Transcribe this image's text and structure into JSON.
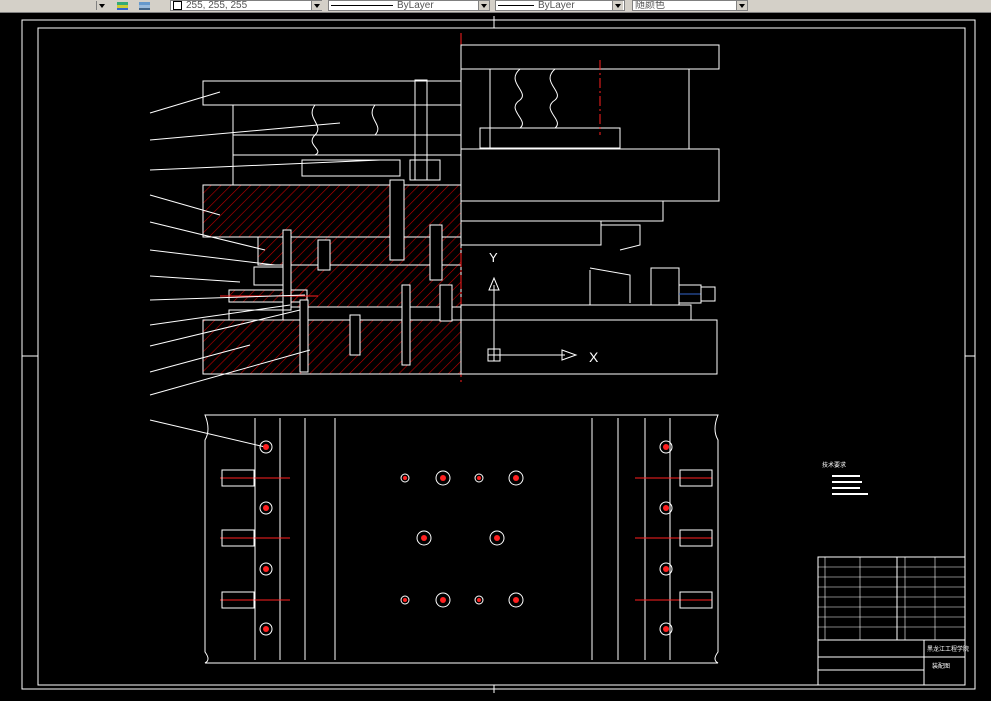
{
  "toolbar": {
    "color_value": "255, 255, 255",
    "linetype_value": "ByLayer",
    "lineweight_value": "ByLayer",
    "plotstyle_value": "随颜色"
  },
  "drawing": {
    "axis_y_label": "Y",
    "axis_x_label": "X",
    "notes_title": "技术要求",
    "title_block_school": "黑龙江工程学院",
    "title_block_drawing": "装配图"
  },
  "colors": {
    "background": "#000000",
    "line": "#ffffff",
    "hatch": "#c00000",
    "centerline": "#ff2020",
    "toolbar": "#d4d0c8"
  }
}
